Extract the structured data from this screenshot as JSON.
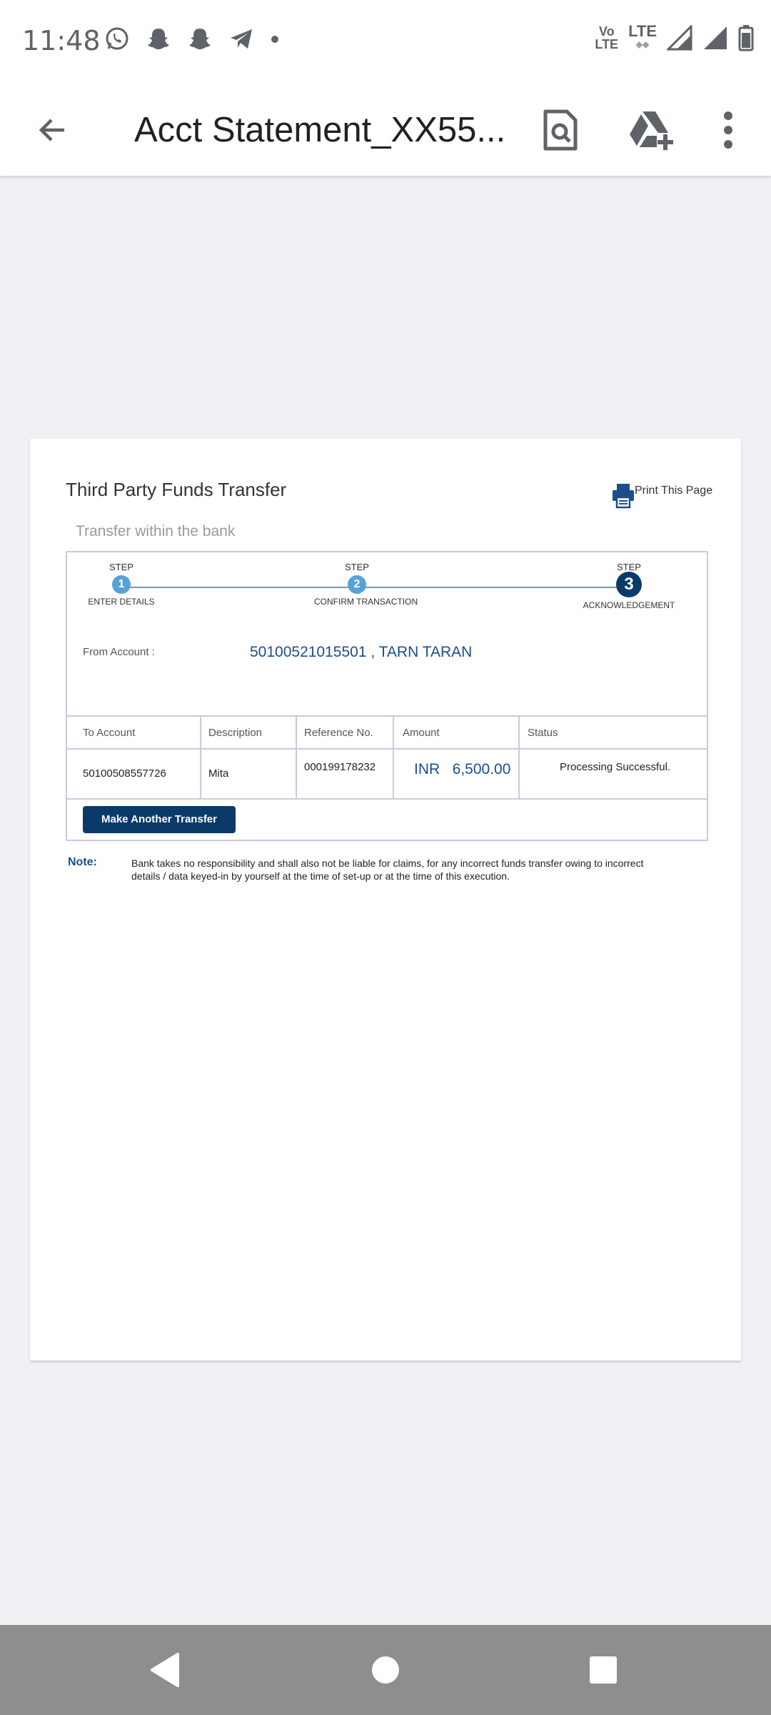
{
  "status_bar": {
    "time": "11:48",
    "left_icons": [
      "whatsapp-icon",
      "snapchat-icon",
      "snapchat-icon",
      "telegram-icon",
      "dot-icon"
    ],
    "volte": [
      "Vo",
      "LTE"
    ],
    "lte": "LTE"
  },
  "app_bar": {
    "title": "Acct Statement_XX55..."
  },
  "document": {
    "title": "Third Party Funds Transfer",
    "print_label": "Print This Page",
    "subtitle": "Transfer within the bank",
    "steps": [
      {
        "word": "STEP",
        "number": "1",
        "label": "ENTER DETAILS"
      },
      {
        "word": "STEP",
        "number": "2",
        "label": "CONFIRM TRANSACTION"
      },
      {
        "word": "STEP",
        "number": "3",
        "label": "ACKNOWLEDGEMENT"
      }
    ],
    "from_label": "From Account :",
    "from_value": "50100521015501 , TARN TARAN",
    "table": {
      "headers": [
        "To Account",
        "Description",
        "Reference No.",
        "Amount",
        "Status"
      ],
      "row": {
        "to_account": "50100508557726",
        "description": "Mita",
        "reference": "000199178232",
        "amount": "INR   6,500.00",
        "status": "Processing Successful."
      }
    },
    "button_label": "Make Another Transfer",
    "note_label": "Note:",
    "note_text": "Bank takes no responsibility and shall also not be liable for claims, for any incorrect funds transfer owing to incorrect details / data keyed-in by yourself at the time of set-up or at the time of this execution."
  },
  "colors": {
    "accent": "#1b4f8c",
    "dark_blue": "#0a3a6a",
    "step_blue": "#58a1d6",
    "border": "#c7cbe0"
  }
}
